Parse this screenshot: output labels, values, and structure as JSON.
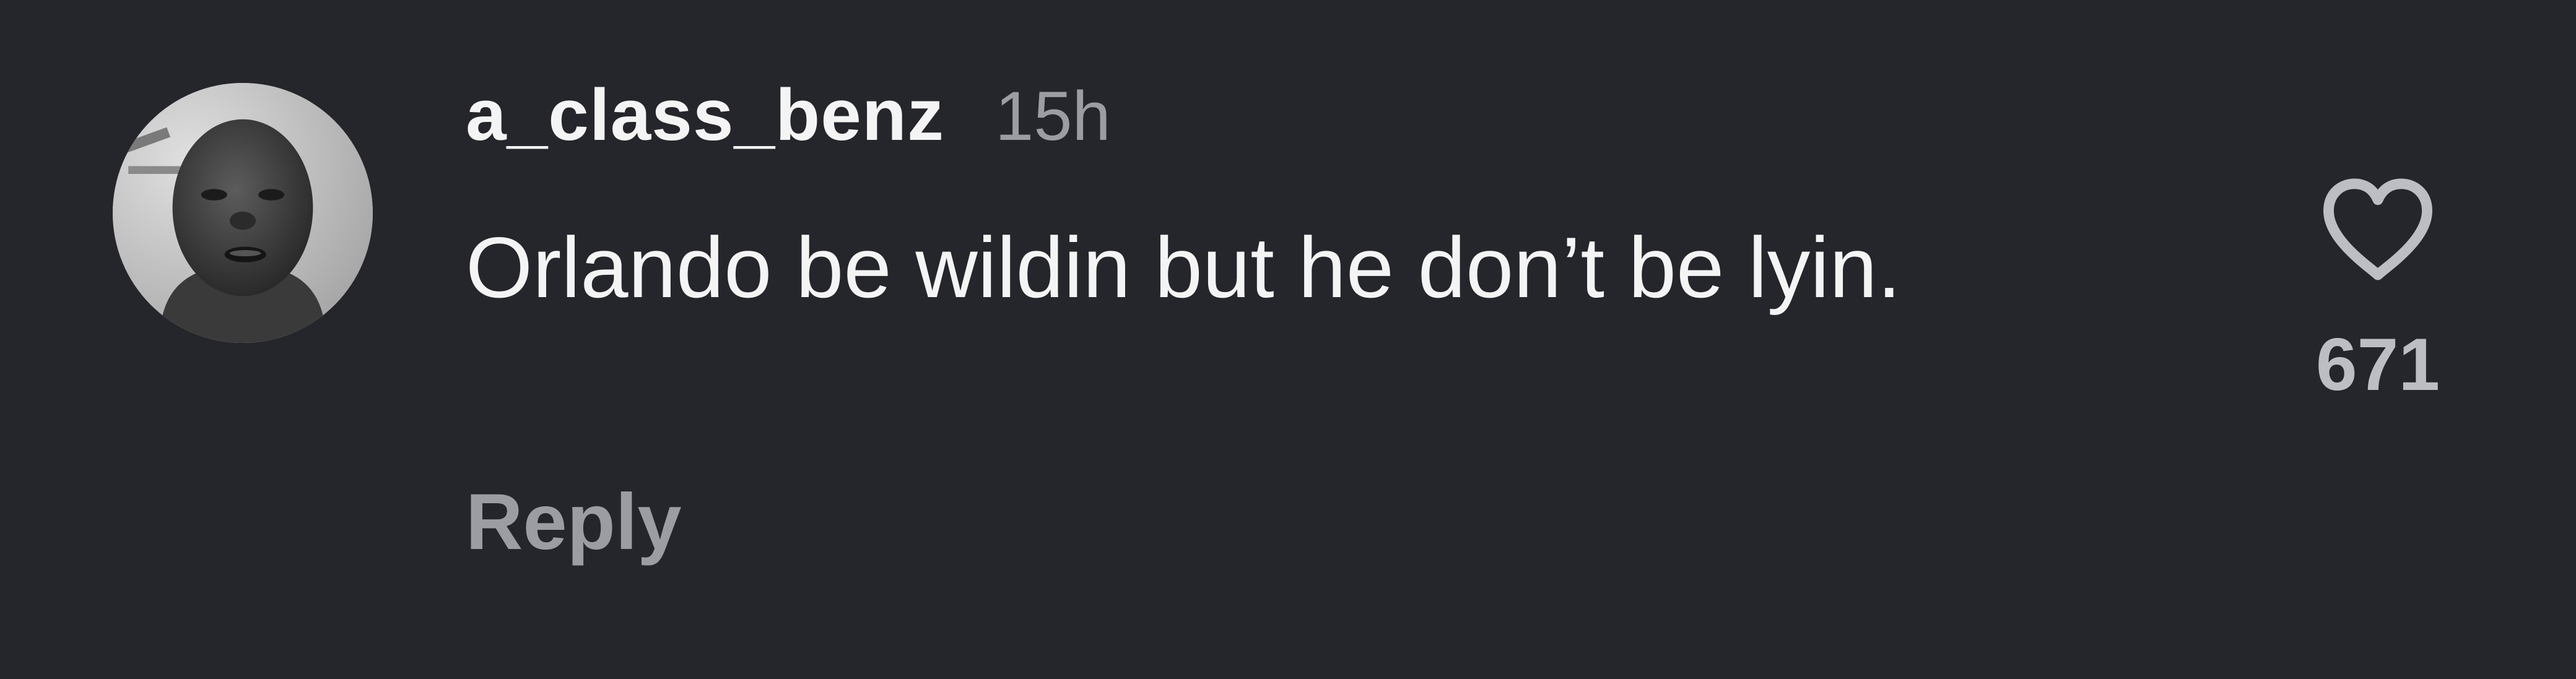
{
  "comment": {
    "avatar_icon": "user-avatar-photo",
    "username": "a_class_benz",
    "timestamp": "15h",
    "text": "Orlando be wildin but he don’t be lyin.",
    "reply_label": "Reply",
    "like_icon": "heart-outline-icon",
    "like_count": "671"
  },
  "colors": {
    "background": "#25262b",
    "primary_text": "#f4f4f4",
    "secondary_text": "#9c9da3",
    "like_icon": "#bdbec3"
  }
}
